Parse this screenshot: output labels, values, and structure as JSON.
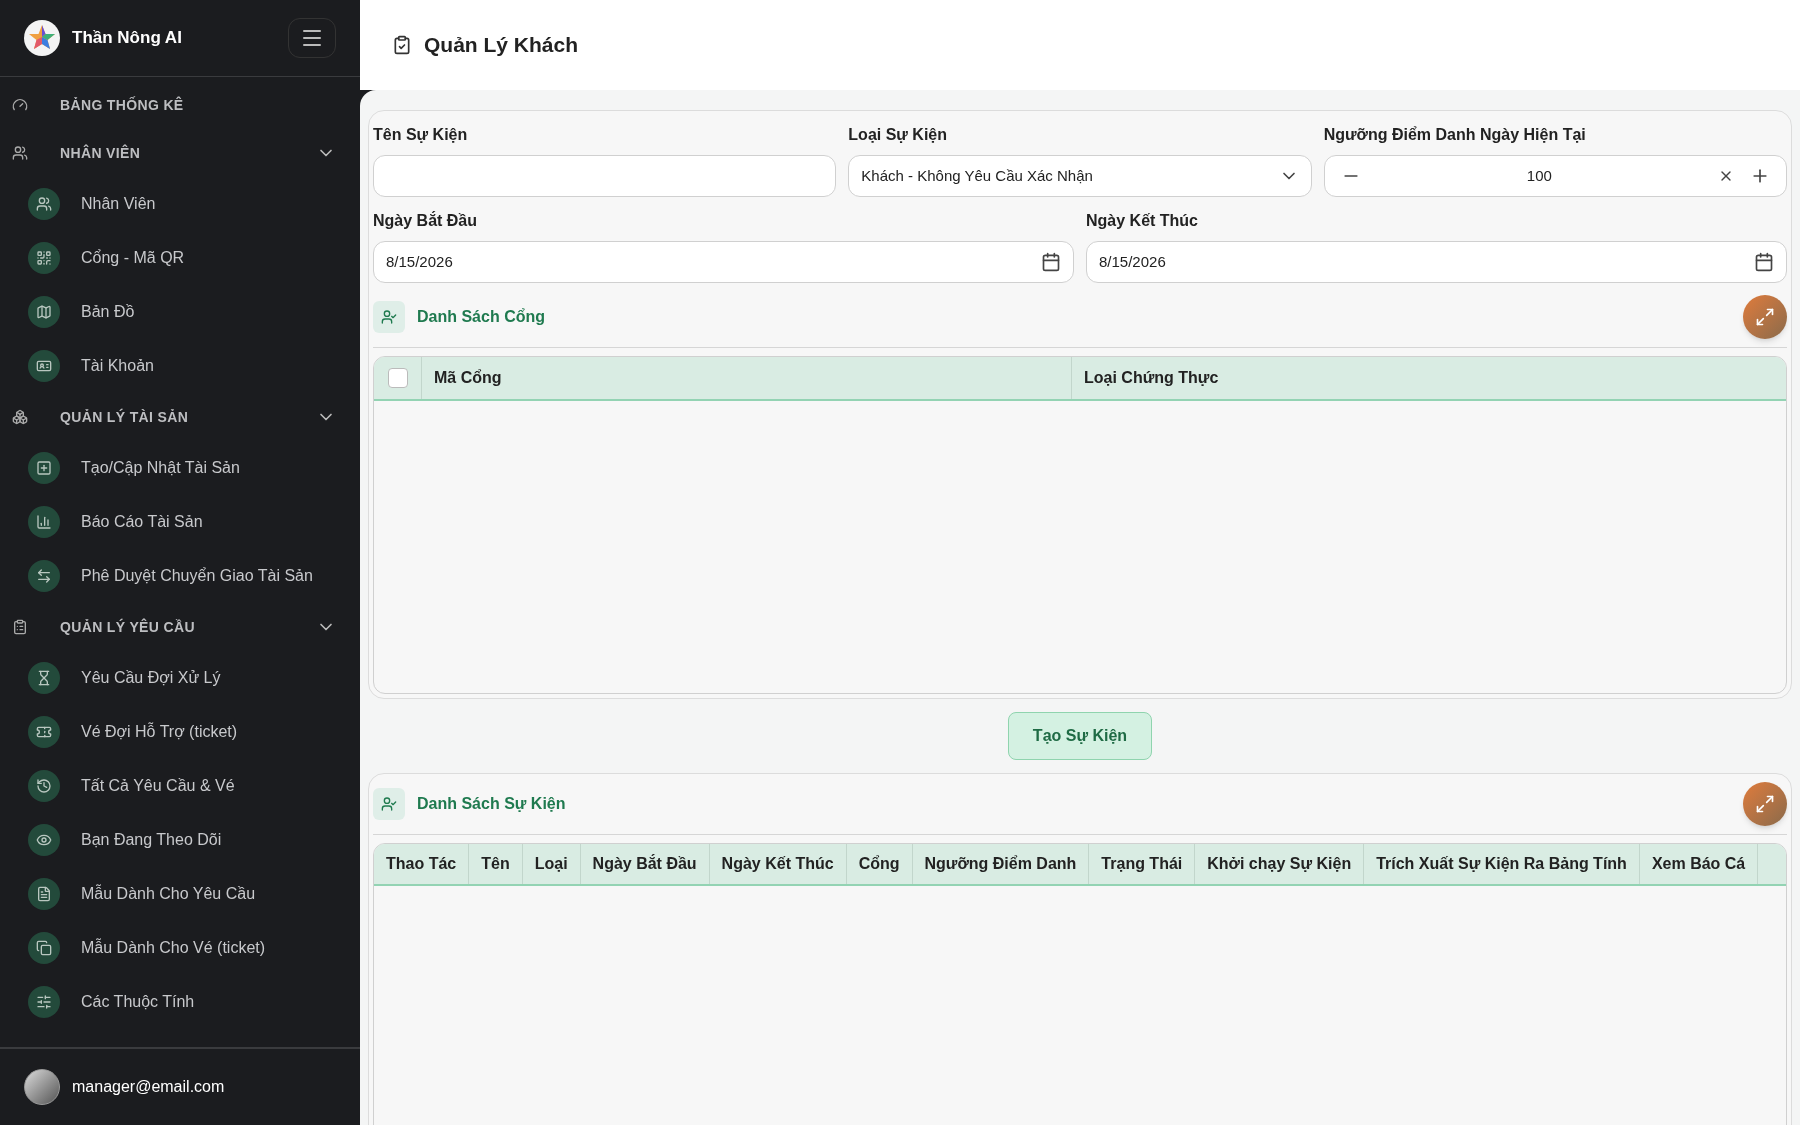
{
  "sidebar": {
    "brand": "Thần Nông AI",
    "menu": [
      {
        "kind": "link",
        "label": "BẢNG THỐNG KÊ"
      },
      {
        "kind": "section",
        "label": "NHÂN VIÊN",
        "expanded": true,
        "children": [
          {
            "label": "Nhân Viên"
          },
          {
            "label": "Cổng - Mã QR"
          },
          {
            "label": "Bản Đồ"
          },
          {
            "label": "Tài Khoản"
          }
        ]
      },
      {
        "kind": "section",
        "label": "QUẢN LÝ TÀI SẢN",
        "expanded": true,
        "children": [
          {
            "label": "Tạo/Cập Nhật Tài Sản"
          },
          {
            "label": "Báo Cáo Tài Sản"
          },
          {
            "label": "Phê Duyệt Chuyển Giao Tài Sản"
          }
        ]
      },
      {
        "kind": "section",
        "label": "QUẢN LÝ YÊU CẦU",
        "expanded": true,
        "children": [
          {
            "label": "Yêu Cầu Đợi Xử Lý"
          },
          {
            "label": "Vé Đợi Hỗ Trợ (ticket)"
          },
          {
            "label": "Tất Cả Yêu Cầu & Vé"
          },
          {
            "label": "Bạn Đang Theo Dõi"
          },
          {
            "label": "Mẫu Dành Cho Yêu Cầu"
          },
          {
            "label": "Mẫu Dành Cho Vé (ticket)"
          },
          {
            "label": "Các Thuộc Tính"
          }
        ]
      }
    ],
    "user": "manager@email.com"
  },
  "page_title": "Quản Lý Khách",
  "form": {
    "name_field": {
      "label": "Tên Sự Kiện"
    },
    "type_field": {
      "label": "Loại Sự Kiện",
      "value": "Khách - Không Yêu Cầu Xác Nhận"
    },
    "threshold_field": {
      "label": "Ngưỡng Điểm Danh Ngày Hiện Tại",
      "value": "100"
    },
    "start_field": {
      "label": "Ngày Bắt Đầu",
      "value": "8/15/2026"
    },
    "end_field": {
      "label": "Ngày Kết Thúc",
      "value": "8/15/2026"
    }
  },
  "gates_panel": {
    "title": "Danh Sách Cổng",
    "select_all_checked": false,
    "columns": [
      "Mã Cổng",
      "Loại Chứng Thực"
    ]
  },
  "create_button": "Tạo Sự Kiện",
  "events_panel": {
    "title": "Danh Sách Sự Kiện",
    "columns": [
      "Thao Tác",
      "Tên",
      "Loại",
      "Ngày Bắt Đầu",
      "Ngày Kết Thúc",
      "Cổng",
      "Ngưỡng Điểm Danh",
      "Trạng Thái",
      "Khởi chạy Sự Kiện",
      "Trích Xuất Sự Kiện Ra Bảng Tính",
      "Xem Báo Cá"
    ]
  }
}
